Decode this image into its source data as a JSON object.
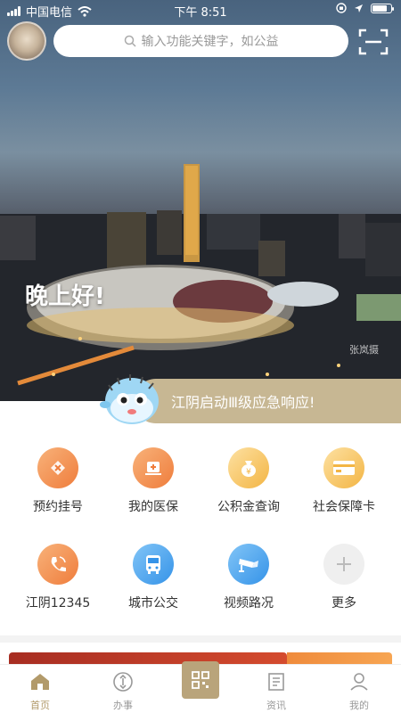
{
  "status_bar": {
    "carrier": "中国电信",
    "time": "下午 8:51"
  },
  "search": {
    "placeholder": "输入功能关键字，如公益"
  },
  "hero": {
    "greeting": "晚上好!",
    "watermark": "张岚摄"
  },
  "notice": {
    "text": "江阴启动Ⅲ级应急响应!"
  },
  "services": [
    {
      "label": "预约挂号",
      "icon": "appointment-icon"
    },
    {
      "label": "我的医保",
      "icon": "medical-insurance-icon"
    },
    {
      "label": "公积金查询",
      "icon": "housing-fund-icon"
    },
    {
      "label": "社会保障卡",
      "icon": "social-security-card-icon"
    },
    {
      "label": "江阴12345",
      "icon": "phone-hotline-icon"
    },
    {
      "label": "城市公交",
      "icon": "bus-icon"
    },
    {
      "label": "视频路况",
      "icon": "camera-icon"
    },
    {
      "label": "更多",
      "icon": "plus-icon"
    }
  ],
  "tabbar": {
    "items": [
      {
        "label": "首页",
        "icon": "home-icon",
        "active": true
      },
      {
        "label": "办事",
        "icon": "service-icon",
        "active": false
      },
      {
        "label": "",
        "icon": "qr-code-icon",
        "active": false
      },
      {
        "label": "资讯",
        "icon": "news-icon",
        "active": false
      },
      {
        "label": "我的",
        "icon": "profile-icon",
        "active": false
      }
    ]
  },
  "colors": {
    "accent": "#b29a6a",
    "notice_bg": "#c7b793",
    "orange": "#ef7d3c",
    "gold": "#f3b544",
    "blue": "#3593e8"
  }
}
